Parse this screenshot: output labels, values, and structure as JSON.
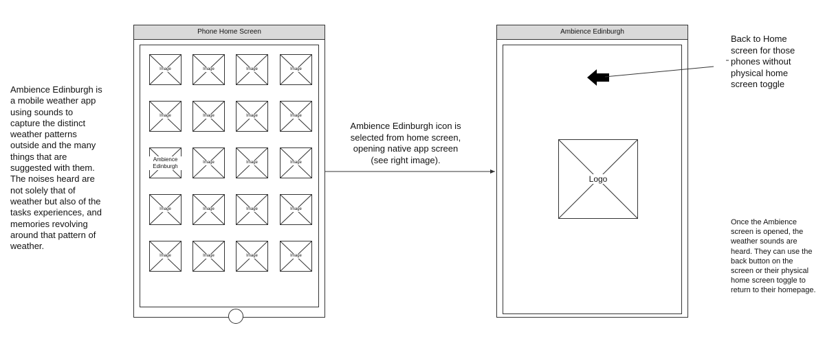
{
  "left_note": "Ambience Edinburgh is a mobile weather app using sounds to capture the distinct weather patterns outside and the many things that are suggested with them. The noises heard are not solely that of weather but also of the tasks experiences, and memories revolving around that pattern of weather.",
  "center_note": "Ambience Edinburgh icon is selected from home screen, opening native app screen (see right image).",
  "back_note": "Back to Home screen for those phones without physical home screen toggle",
  "bottom_note": "Once the Ambience screen is opened, the weather sounds are heard. They can use the back button on the screen or their physical home screen toggle to return to their homepage.",
  "home_phone": {
    "title": "Phone Home Screen",
    "icons": [
      "Image",
      "Image",
      "Image",
      "Image",
      "Image",
      "Image",
      "Image",
      "Image",
      "Ambience Edinburgh",
      "Image",
      "Image",
      "Image",
      "Image",
      "Image",
      "Image",
      "Image",
      "Image",
      "Image",
      "Image",
      "Image"
    ]
  },
  "app_phone": {
    "title": "Ambience Edinburgh",
    "logo_label": "Logo"
  }
}
